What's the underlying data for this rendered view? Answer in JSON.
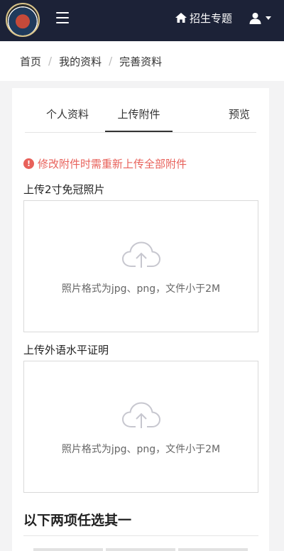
{
  "navbar": {
    "logo_icon": "school-emblem-icon",
    "menu_icon": "hamburger-menu-icon",
    "home_icon": "home-icon",
    "admissions_label": "招生专题",
    "user_icon": "user-icon",
    "caret_icon": "caret-down-icon"
  },
  "breadcrumb": {
    "items": [
      "首页",
      "我的资料",
      "完善资料"
    ],
    "separator": "/"
  },
  "tabs": {
    "personal": "个人资料",
    "upload": "上传附件",
    "preview": "预览",
    "active": "上传附件"
  },
  "notice": {
    "icon": "exclamation-circle-icon",
    "text": "修改附件时需重新上传全部附件",
    "color": "#e8615a"
  },
  "uploads": [
    {
      "label": "上传2寸免冠照片",
      "icon": "cloud-upload-icon",
      "hint": "照片格式为jpg、png，文件小于2M"
    },
    {
      "label": "上传外语水平证明",
      "icon": "cloud-upload-icon",
      "hint": "照片格式为jpg、png，文件小于2M"
    }
  ],
  "choose_one_title": "以下两项任选其一",
  "colors": {
    "navbar_bg": "#1c2237",
    "page_bg": "#f3f3f4",
    "accent_warning": "#e8615a"
  }
}
